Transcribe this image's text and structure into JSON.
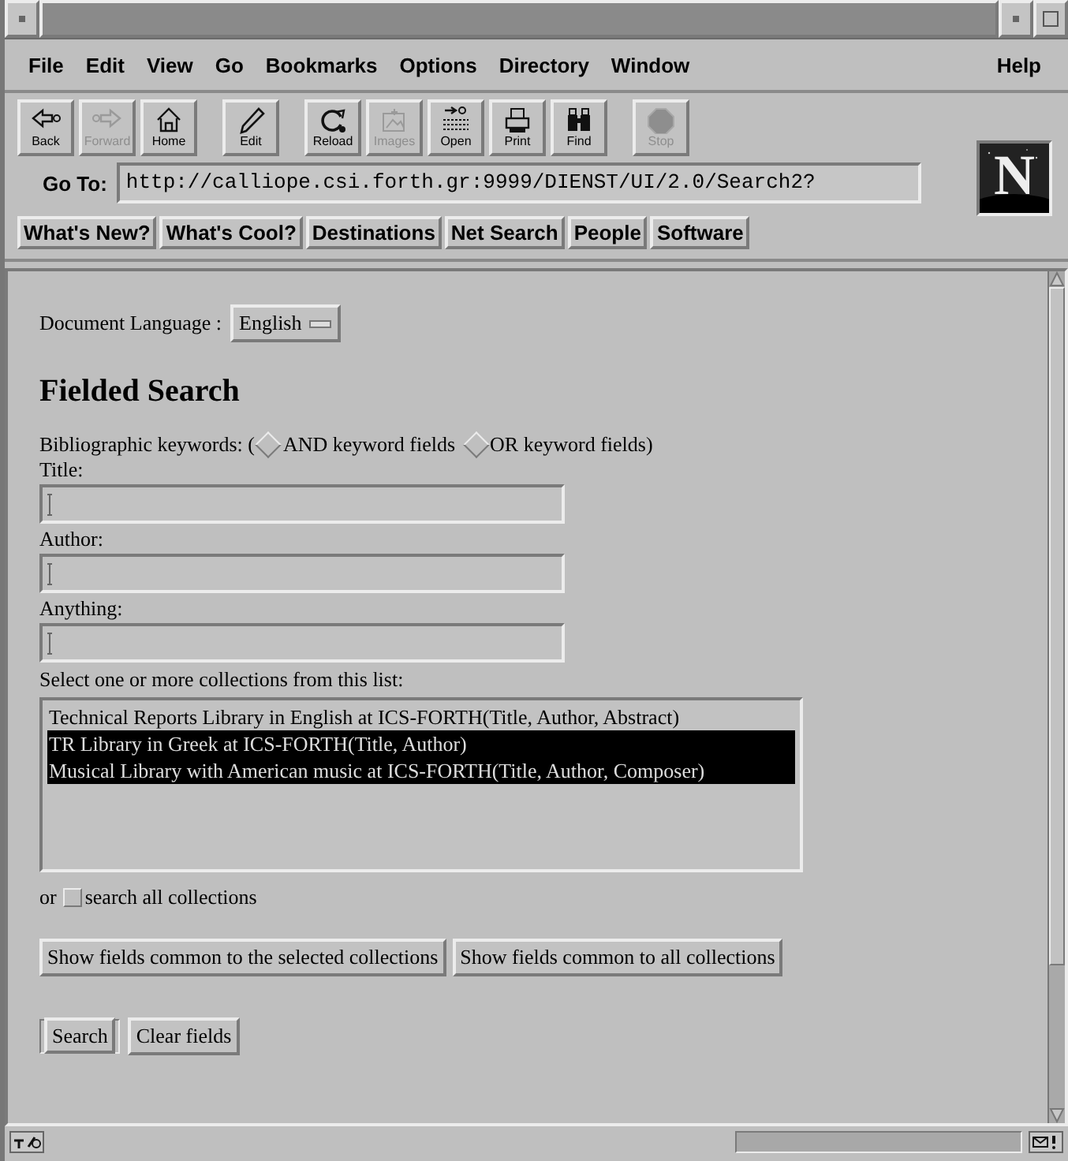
{
  "menu": [
    "File",
    "Edit",
    "View",
    "Go",
    "Bookmarks",
    "Options",
    "Directory",
    "Window"
  ],
  "help_menu": "Help",
  "toolbar_groups": [
    [
      {
        "label": "Back",
        "disabled": false
      },
      {
        "label": "Forward",
        "disabled": true
      },
      {
        "label": "Home",
        "disabled": false
      }
    ],
    [
      {
        "label": "Edit",
        "disabled": false
      }
    ],
    [
      {
        "label": "Reload",
        "disabled": false
      },
      {
        "label": "Images",
        "disabled": true
      },
      {
        "label": "Open",
        "disabled": false
      },
      {
        "label": "Print",
        "disabled": false
      },
      {
        "label": "Find",
        "disabled": false
      }
    ],
    [
      {
        "label": "Stop",
        "disabled": true
      }
    ]
  ],
  "location": {
    "label": "Go To:",
    "value": "http://calliope.csi.forth.gr:9999/DIENST/UI/2.0/Search2?"
  },
  "logo": "N",
  "directory_buttons": [
    "What's New?",
    "What's Cool?",
    "Destinations",
    "Net Search",
    "People",
    "Software"
  ],
  "page": {
    "language_label": "Document Language :",
    "language_value": "English",
    "heading": "Fielded Search",
    "keywords_label": "Bibliographic keywords: (",
    "radios": [
      {
        "label": "AND keyword fields",
        "selected": false
      },
      {
        "label": "OR keyword fields)",
        "selected": false
      }
    ],
    "fields": [
      {
        "label": "Title:"
      },
      {
        "label": "Author:"
      },
      {
        "label": "Anything:"
      }
    ],
    "collections_label": "Select one or more collections from this list:",
    "collections": [
      {
        "label": "Technical Reports Library in English at ICS-FORTH(Title, Author, Abstract)",
        "selected": false
      },
      {
        "label": "TR Library in Greek at ICS-FORTH(Title, Author)",
        "selected": true
      },
      {
        "label": "Musical Library with American music at ICS-FORTH(Title, Author, Composer)",
        "selected": true
      }
    ],
    "search_all": {
      "prefix": "or",
      "label": "search all collections",
      "checked": false
    },
    "field_buttons": [
      "Show fields common to the selected collections",
      "Show fields common to all collections"
    ],
    "action_buttons": [
      {
        "label": "Search",
        "default": true
      },
      {
        "label": "Clear fields",
        "default": false
      }
    ]
  }
}
